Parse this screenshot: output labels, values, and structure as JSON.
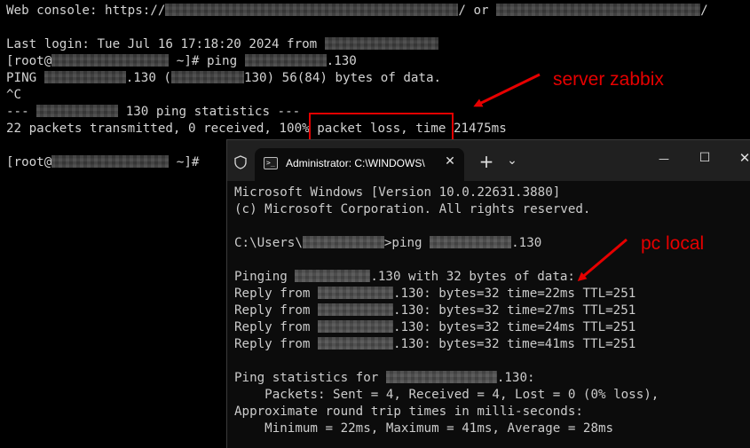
{
  "linux_console": {
    "line1": {
      "pre": "Web console: https://",
      "mid": "/ or ",
      "post": "/"
    },
    "line2": {
      "pre": "Last login: Tue Jul 16 17:18:20 2024 from "
    },
    "line3": {
      "pre": "[root@",
      "mid": " ~]# ping ",
      "post": ".130"
    },
    "line4": {
      "pre": "PING ",
      "mid": ".130 (",
      "post": "130) 56(84) bytes of data."
    },
    "line5": {
      "text": "^C"
    },
    "line6": {
      "pre": "--- ",
      "post": " 130 ping statistics ---"
    },
    "line7": {
      "text": "22 packets transmitted, 0 received, 100% packet loss, time 21475ms"
    },
    "line8": {
      "pre": "[root@",
      "post": " ~]# "
    }
  },
  "annotations": {
    "server": "server zabbix",
    "pc": "pc local"
  },
  "windows_terminal": {
    "tab_title": "Administrator: C:\\WINDOWS\\",
    "tab_close": "✕",
    "new_tab": "+",
    "dropdown": "⌄",
    "minimize": "—",
    "maximize": "☐",
    "close": "✕",
    "lines": {
      "l1": "Microsoft Windows [Version 10.0.22631.3880]",
      "l2": "(c) Microsoft Corporation. All rights reserved.",
      "l3_pre": "C:\\Users\\",
      "l3_mid": ">ping ",
      "l3_post": ".130",
      "l4_pre": "Pinging ",
      "l4_post": ".130 with 32 bytes of data:",
      "reply_pre": "Reply from ",
      "r1": ".130: bytes=32 time=22ms TTL=251",
      "r2": ".130: bytes=32 time=27ms TTL=251",
      "r3": ".130: bytes=32 time=24ms TTL=251",
      "r4": ".130: bytes=32 time=41ms TTL=251",
      "stats_pre": "Ping statistics for ",
      "stats_post": ".130:",
      "packets": "    Packets: Sent = 4, Received = 4, Lost = 0 (0% loss),",
      "approx": "Approximate round trip times in milli-seconds:",
      "minmax": "    Minimum = 22ms, Maximum = 41ms, Average = 28ms"
    }
  },
  "colors": {
    "annotation_red": "#e60000",
    "linux_text": "#d3d3d3",
    "windows_text": "#cccccc"
  }
}
